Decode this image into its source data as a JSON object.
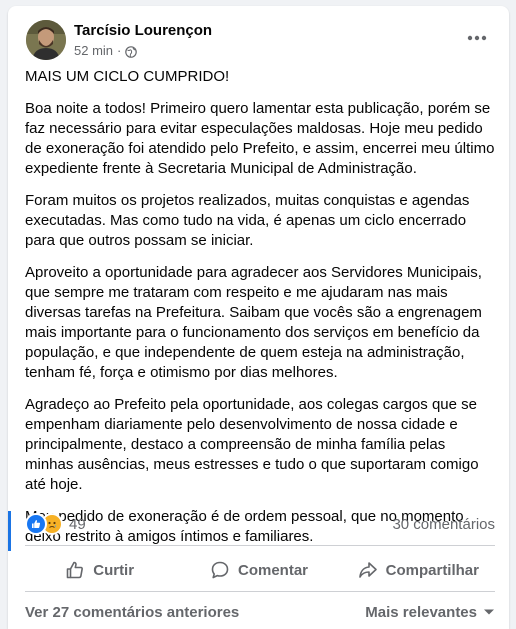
{
  "post": {
    "author": "Tarcísio Lourençon",
    "time": "52 min",
    "separator": "·",
    "privacy_icon": "globe-icon",
    "more_icon": "more-horizontal-icon",
    "paragraphs": [
      "MAIS UM CICLO CUMPRIDO!",
      "Boa noite a todos! Primeiro quero lamentar esta publicação, porém se faz necessário para evitar especulações maldosas. Hoje meu pedido de exoneração foi atendido pelo Prefeito, e assim, encerrei meu último expediente frente à Secretaria Municipal de Administração.",
      "Foram muitos os projetos realizados, muitas conquistas e agendas executadas. Mas como tudo na vida, é apenas um ciclo encerrado para que outros possam se iniciar.",
      "Aproveito a oportunidade para agradecer aos Servidores Municipais, que sempre me trataram com respeito e me ajudaram nas mais diversas tarefas na Prefeitura. Saibam que vocês são a engrenagem mais importante para o funcionamento dos serviços em benefício da população, e que independente de quem esteja na administração, tenham fé, força e otimismo por dias melhores.",
      "Agradeço ao Prefeito pela oportunidade, aos colegas cargos que se empenham diariamente pelo desenvolvimento de nossa cidade e principalmente, destaco a compreensão de minha família pelas minhas ausências, meus estresses e tudo o que suportaram comigo até hoje.",
      "Meu pedido de exoneração é de ordem pessoal, que no momento deixo restrito à amigos íntimos e familiares."
    ]
  },
  "reactions": {
    "icons": [
      "like-icon",
      "sad-icon"
    ],
    "count": "49",
    "comments": "30 comentários"
  },
  "actions": {
    "like": "Curtir",
    "comment": "Comentar",
    "share": "Compartilhar"
  },
  "comments_footer": {
    "view_more": "Ver 27 comentários anteriores",
    "sort": "Mais relevantes"
  },
  "colors": {
    "background": "#f0f2f5",
    "card": "#ffffff",
    "text_primary": "#050505",
    "text_secondary": "#65676b",
    "like_blue": "#1877f2",
    "sad_yellow": "#f7b125",
    "divider": "#ced0d4"
  }
}
